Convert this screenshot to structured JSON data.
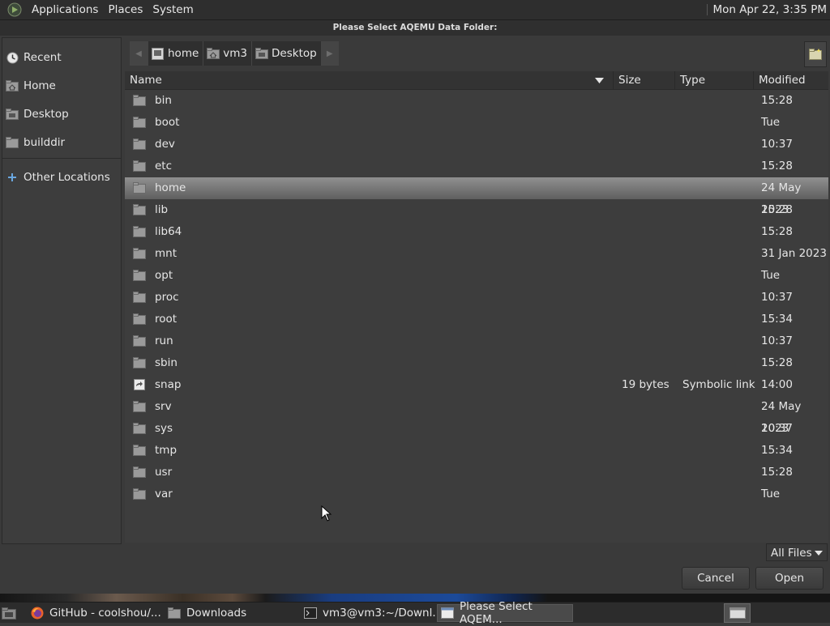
{
  "top_panel": {
    "menus": [
      "Applications",
      "Places",
      "System"
    ],
    "clock": "Mon Apr 22,  3:35 PM"
  },
  "dialog": {
    "title": "Please Select AQEMU Data Folder:"
  },
  "sidebar": {
    "items": [
      {
        "label": "Recent",
        "icon": "clock-icon"
      },
      {
        "label": "Home",
        "icon": "home-icon"
      },
      {
        "label": "Desktop",
        "icon": "desktop-folder-icon"
      },
      {
        "label": "builddir",
        "icon": "folder-icon"
      }
    ],
    "other": {
      "label": "Other Locations",
      "icon": "plus-icon"
    }
  },
  "pathbar": {
    "segments": [
      {
        "label": "home",
        "icon": "drive-icon"
      },
      {
        "label": "vm3",
        "icon": "home-icon"
      },
      {
        "label": "Desktop",
        "icon": "desktop-folder-icon"
      }
    ]
  },
  "list": {
    "columns": {
      "name": "Name",
      "size": "Size",
      "type": "Type",
      "modified": "Modified"
    },
    "rows": [
      {
        "name": "bin",
        "size": "",
        "type": "",
        "modified": "15:28"
      },
      {
        "name": "boot",
        "size": "",
        "type": "",
        "modified": "Tue"
      },
      {
        "name": "dev",
        "size": "",
        "type": "",
        "modified": "10:37"
      },
      {
        "name": "etc",
        "size": "",
        "type": "",
        "modified": "15:28"
      },
      {
        "name": "home",
        "size": "",
        "type": "",
        "modified": "24 May 2023",
        "selected": true
      },
      {
        "name": "lib",
        "size": "",
        "type": "",
        "modified": "15:28"
      },
      {
        "name": "lib64",
        "size": "",
        "type": "",
        "modified": "15:28"
      },
      {
        "name": "mnt",
        "size": "",
        "type": "",
        "modified": "31 Jan 2023"
      },
      {
        "name": "opt",
        "size": "",
        "type": "",
        "modified": "Tue"
      },
      {
        "name": "proc",
        "size": "",
        "type": "",
        "modified": "10:37"
      },
      {
        "name": "root",
        "size": "",
        "type": "",
        "modified": "15:34"
      },
      {
        "name": "run",
        "size": "",
        "type": "",
        "modified": "10:37"
      },
      {
        "name": "sbin",
        "size": "",
        "type": "",
        "modified": "15:28"
      },
      {
        "name": "snap",
        "size": "19 bytes",
        "type": "Symbolic link",
        "modified": "14:00",
        "icon": "symlink-file-icon"
      },
      {
        "name": "srv",
        "size": "",
        "type": "",
        "modified": "24 May 2023"
      },
      {
        "name": "sys",
        "size": "",
        "type": "",
        "modified": "10:37"
      },
      {
        "name": "tmp",
        "size": "",
        "type": "",
        "modified": "15:34"
      },
      {
        "name": "usr",
        "size": "",
        "type": "",
        "modified": "15:28"
      },
      {
        "name": "var",
        "size": "",
        "type": "",
        "modified": "Tue"
      }
    ]
  },
  "filter": {
    "selected": "All Files"
  },
  "buttons": {
    "cancel": "Cancel",
    "open": "Open"
  },
  "taskbar": {
    "tasks": [
      {
        "label": "GitHub - coolshou/...",
        "icon": "firefox-icon"
      },
      {
        "label": "Downloads",
        "icon": "folder-icon"
      },
      {
        "label": "vm3@vm3:~/Downl...",
        "icon": "terminal-icon"
      },
      {
        "label": "Please Select AQEM...",
        "icon": "window-icon",
        "active": true
      }
    ]
  },
  "colors": {
    "accent_selected": "#7a7a7a",
    "background": "#3a3a3a"
  }
}
